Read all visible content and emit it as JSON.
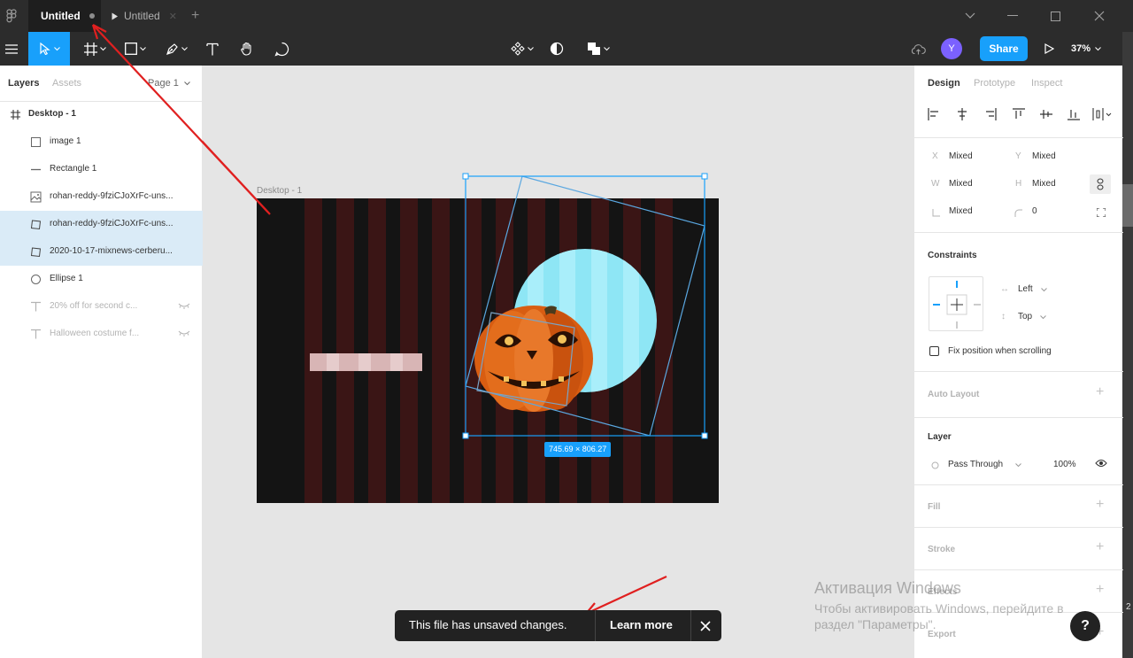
{
  "title_bar": {
    "tabs": [
      {
        "label": "Untitled",
        "active": true,
        "unsaved": true
      },
      {
        "label": "Untitled",
        "active": false,
        "prototype": true
      }
    ],
    "new_tab_icon": "plus-icon",
    "window_controls": [
      "chevron-down-icon",
      "minimize-icon",
      "maximize-icon",
      "close-icon"
    ]
  },
  "toolbar": {
    "tools": [
      "menu-icon",
      "move-tool-icon",
      "frame-tool-icon",
      "shape-tool-icon",
      "pen-tool-icon",
      "text-tool-icon",
      "hand-tool-icon",
      "comment-tool-icon"
    ],
    "center_tools": [
      "component-icon",
      "mask-icon",
      "boolean-icon"
    ],
    "avatar_initial": "Y",
    "share_label": "Share",
    "zoom": "37%"
  },
  "layers_panel": {
    "tabs": {
      "layers": "Layers",
      "assets": "Assets",
      "page": "Page 1"
    },
    "frame_name": "Desktop - 1",
    "items": [
      {
        "name": "image 1",
        "icon": "rectangle-icon",
        "selected": false,
        "hidden": false
      },
      {
        "name": "Rectangle 1",
        "icon": "line-icon",
        "selected": false,
        "hidden": false
      },
      {
        "name": "rohan-reddy-9fziCJoXrFc-uns...",
        "icon": "image-icon",
        "selected": false,
        "hidden": false
      },
      {
        "name": "rohan-reddy-9fziCJoXrFc-uns...",
        "icon": "rotated-rect-icon",
        "selected": true,
        "hidden": false
      },
      {
        "name": "2020-10-17-mixnews-cerberu...",
        "icon": "rotated-rect-icon",
        "selected": true,
        "hidden": false
      },
      {
        "name": "Ellipse 1",
        "icon": "ellipse-icon",
        "selected": false,
        "hidden": false
      },
      {
        "name": "20% off for second c...",
        "icon": "text-icon",
        "selected": false,
        "hidden": true
      },
      {
        "name": "Halloween costume f...",
        "icon": "text-icon",
        "selected": false,
        "hidden": true
      }
    ]
  },
  "canvas": {
    "frame_label": "Desktop - 1",
    "selection_size": "745.69 × 806.27",
    "colors": {
      "canvas_bg": "#e5e5e5",
      "frame_bg": "#141414",
      "stripe": "#3a1515",
      "circle": "#8ee6f5",
      "selection": "#18a0fb"
    }
  },
  "design_panel": {
    "tabs": {
      "design": "Design",
      "prototype": "Prototype",
      "inspect": "Inspect"
    },
    "position": {
      "x_label": "X",
      "x_value": "Mixed",
      "y_label": "Y",
      "y_value": "Mixed",
      "w_label": "W",
      "w_value": "Mixed",
      "h_label": "H",
      "h_value": "Mixed",
      "rotation_value": "Mixed",
      "radius_value": "0"
    },
    "constraints": {
      "title": "Constraints",
      "horizontal": "Left",
      "vertical": "Top",
      "fix_position_label": "Fix position when scrolling"
    },
    "auto_layout": "Auto Layout",
    "layer": {
      "title": "Layer",
      "blend": "Pass Through",
      "opacity": "100%"
    },
    "fill": "Fill",
    "stroke": "Stroke",
    "effects": "Effects",
    "export": "Export"
  },
  "toast": {
    "message": "This file has unsaved changes.",
    "action": "Learn more"
  },
  "activation_watermark": {
    "line1": "Активация Windows",
    "line2": "Чтобы активировать Windows, перейдите в",
    "line3": "раздел \"Параметры\"."
  },
  "help_label": "?",
  "edge_text": "2"
}
